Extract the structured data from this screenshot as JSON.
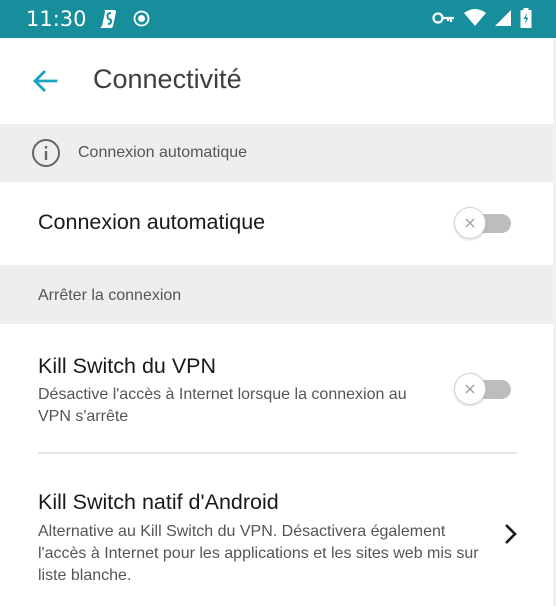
{
  "status_bar": {
    "time": "11:30",
    "icons": [
      "app-notification-icon",
      "record-icon",
      "vpn-key-icon",
      "wifi-icon",
      "cell-signal-icon",
      "battery-icon"
    ],
    "background_color": "#178e9b"
  },
  "app_bar": {
    "title": "Connectivité",
    "back_icon": "arrow-left-icon",
    "accent_color": "#1aa3c4"
  },
  "info_header": {
    "icon": "info-icon",
    "text": "Connexion automatique"
  },
  "auto_connect": {
    "title": "Connexion automatique",
    "enabled": false
  },
  "section_header": {
    "text": "Arrêter la connexion"
  },
  "kill_switch": {
    "title": "Kill Switch du VPN",
    "description": "Désactive l'accès à Internet lorsque la connexion au VPN s'arrête",
    "enabled": false
  },
  "native_kill_switch": {
    "title": "Kill Switch natif d'Android",
    "description": "Alternative au Kill Switch du VPN. Désactivera également l'accès à Internet pour les applications et les sites web mis sur liste blanche.",
    "icon": "chevron-right-icon"
  }
}
